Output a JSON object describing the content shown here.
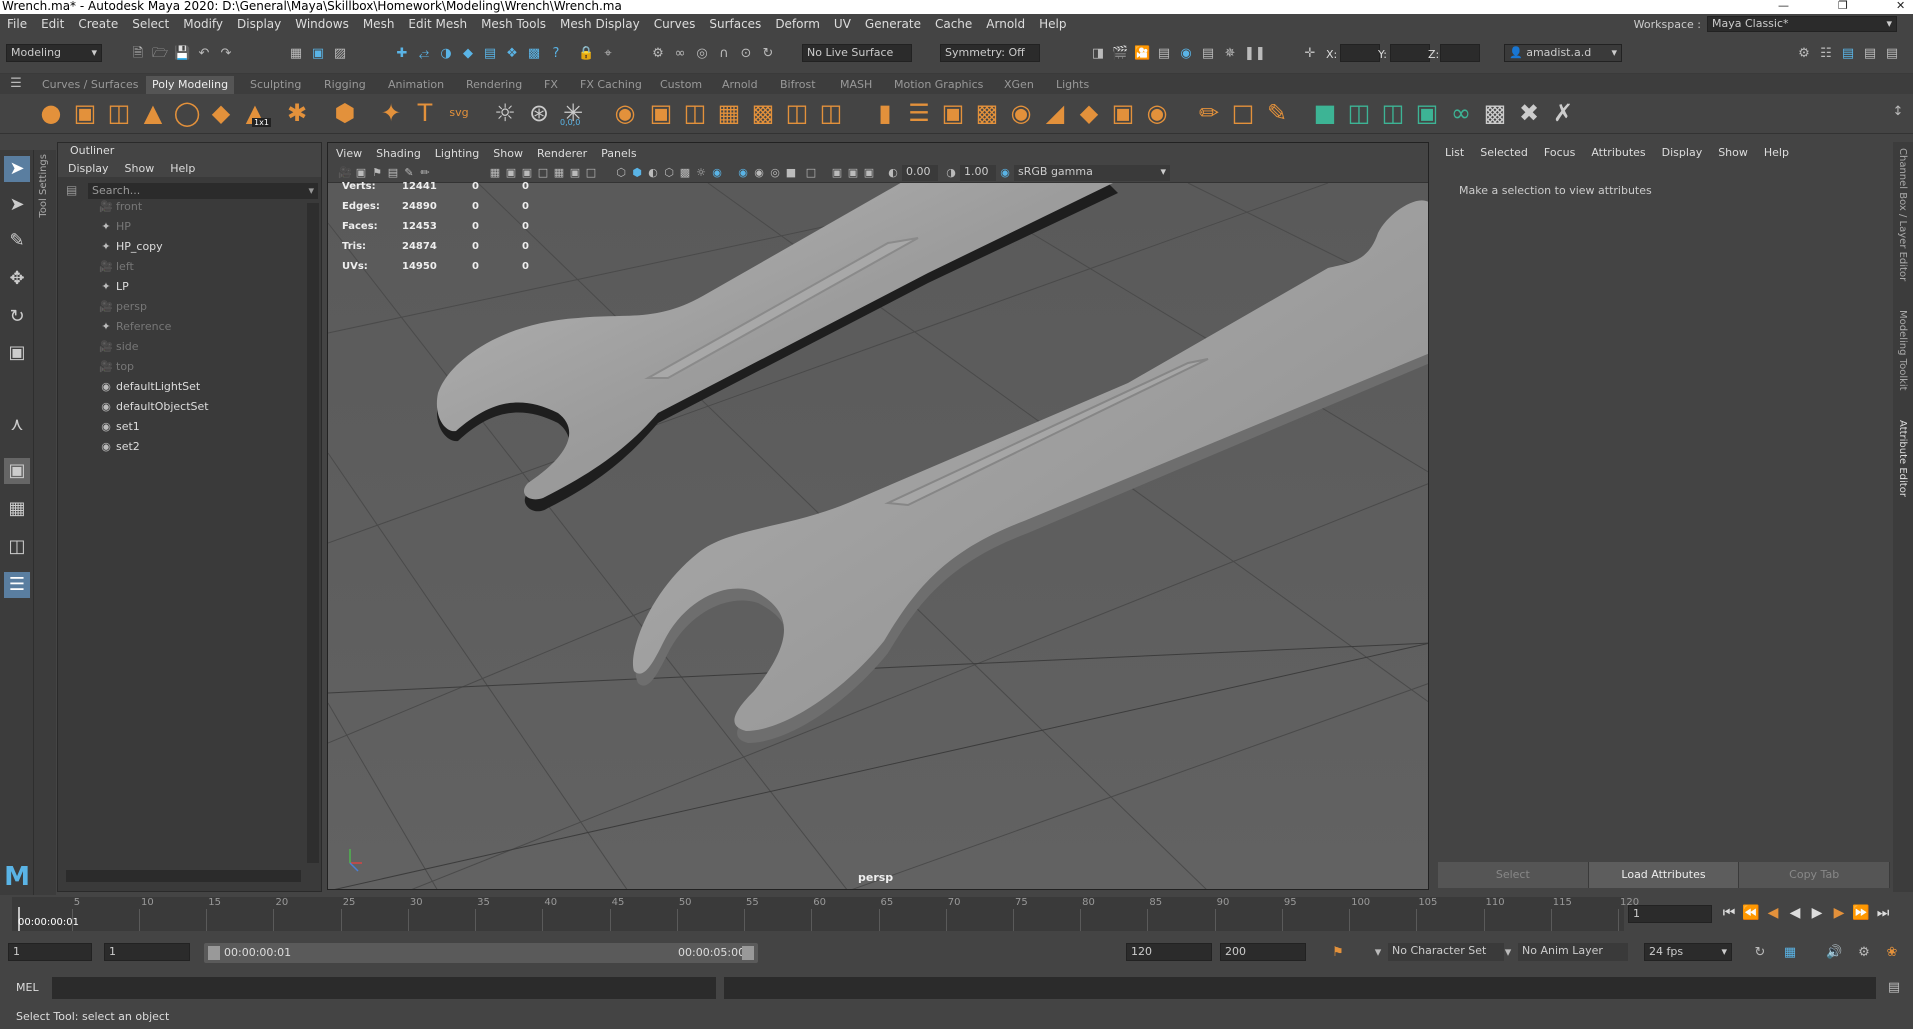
{
  "title_bar": {
    "text": "Wrench.ma* - Autodesk Maya 2020: D:\\General\\Maya\\Skillbox\\Homework\\Modeling\\Wrench\\Wrench.ma"
  },
  "menu": [
    "File",
    "Edit",
    "Create",
    "Select",
    "Modify",
    "Display",
    "Windows",
    "Mesh",
    "Edit Mesh",
    "Mesh Tools",
    "Mesh Display",
    "Curves",
    "Surfaces",
    "Deform",
    "UV",
    "Generate",
    "Cache",
    "Arnold",
    "Help"
  ],
  "workspace": {
    "label": "Workspace :",
    "value": "Maya Classic*"
  },
  "status_line": {
    "mode": "Modeling",
    "live_surface": "No Live Surface",
    "symmetry": "Symmetry: Off",
    "x_label": "X:",
    "y_label": "Y:",
    "z_label": "Z:",
    "user": "amadist.a.d"
  },
  "shelf_tabs": [
    "Curves / Surfaces",
    "Poly Modeling",
    "Sculpting",
    "Rigging",
    "Animation",
    "Rendering",
    "FX",
    "FX Caching",
    "Custom",
    "Arnold",
    "Bifrost",
    "MASH",
    "Motion Graphics",
    "XGen",
    "Lights"
  ],
  "shelf_active": "Poly Modeling",
  "shelf_badge": "1x1",
  "shelf_svg_label": "svg",
  "shelf_text_label": "T",
  "shelf_coord_label": "0,0,0",
  "tool_settings_label": "Tool Settings",
  "outliner": {
    "title": "Outliner",
    "menu": [
      "Display",
      "Show",
      "Help"
    ],
    "search_placeholder": "Search...",
    "items": [
      {
        "name": "front",
        "icon": "camera-icon",
        "dim": true
      },
      {
        "name": "HP",
        "icon": "transform-icon",
        "dim": true
      },
      {
        "name": "HP_copy",
        "icon": "transform-icon",
        "dim": false
      },
      {
        "name": "left",
        "icon": "camera-icon",
        "dim": true
      },
      {
        "name": "LP",
        "icon": "transform-icon",
        "dim": false
      },
      {
        "name": "persp",
        "icon": "camera-icon",
        "dim": true
      },
      {
        "name": "Reference",
        "icon": "transform-icon",
        "dim": true
      },
      {
        "name": "side",
        "icon": "camera-icon",
        "dim": true
      },
      {
        "name": "top",
        "icon": "camera-icon",
        "dim": true
      },
      {
        "name": "defaultLightSet",
        "icon": "set-icon",
        "dim": false
      },
      {
        "name": "defaultObjectSet",
        "icon": "set-icon",
        "dim": false
      },
      {
        "name": "set1",
        "icon": "set-icon",
        "dim": false
      },
      {
        "name": "set2",
        "icon": "set-icon",
        "dim": false
      }
    ]
  },
  "viewport": {
    "menu": [
      "View",
      "Shading",
      "Lighting",
      "Show",
      "Renderer",
      "Panels"
    ],
    "exposure": "0.00",
    "gamma": "1.00",
    "color_space": "sRGB gamma",
    "camera": "persp",
    "hud": [
      {
        "label": "Verts:",
        "v1": "12441",
        "v2": "0",
        "v3": "0"
      },
      {
        "label": "Edges:",
        "v1": "24890",
        "v2": "0",
        "v3": "0"
      },
      {
        "label": "Faces:",
        "v1": "12453",
        "v2": "0",
        "v3": "0"
      },
      {
        "label": "Tris:",
        "v1": "24874",
        "v2": "0",
        "v3": "0"
      },
      {
        "label": "UVs:",
        "v1": "14950",
        "v2": "0",
        "v3": "0"
      }
    ]
  },
  "attribute_editor": {
    "menu": [
      "List",
      "Selected",
      "Focus",
      "Attributes",
      "Display",
      "Show",
      "Help"
    ],
    "message": "Make a selection to view attributes",
    "buttons": [
      "Select",
      "Load Attributes",
      "Copy Tab"
    ]
  },
  "right_tabs": [
    "Channel Box / Layer Editor",
    "Modeling Toolkit",
    "Attribute Editor"
  ],
  "time_slider": {
    "ticks": [
      "5",
      "10",
      "15",
      "20",
      "25",
      "30",
      "35",
      "40",
      "45",
      "50",
      "55",
      "60",
      "65",
      "70",
      "75",
      "80",
      "85",
      "90",
      "95",
      "100",
      "105",
      "110",
      "115",
      "120"
    ],
    "current_time": "00:00:00:01",
    "current_frame": "1"
  },
  "range": {
    "start": "1",
    "start2": "1",
    "range_start_time": "00:00:00:01",
    "range_end_time": "00:00:05:00",
    "end": "120",
    "end2": "200",
    "character_set": "No Character Set",
    "anim_layer": "No Anim Layer",
    "fps": "24 fps"
  },
  "command_line": {
    "label": "MEL"
  },
  "help_line": "Select Tool: select an object",
  "colors": {
    "accent": "#5ab4e6",
    "shelf_orange": "#e3913b",
    "shelf_teal": "#3db495"
  }
}
